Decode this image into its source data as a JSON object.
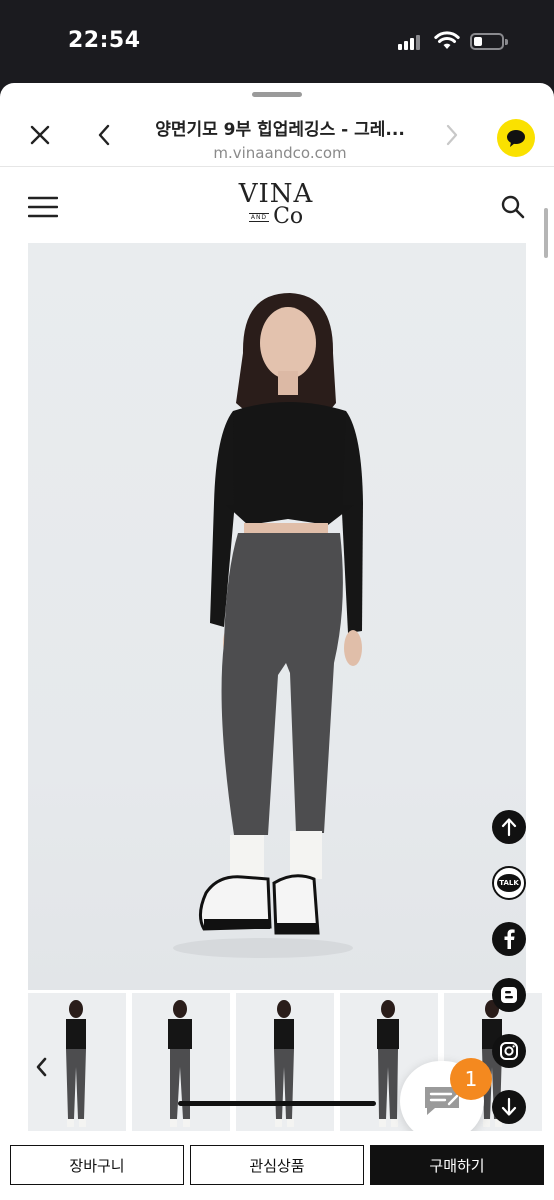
{
  "status_bar": {
    "time": "22:54"
  },
  "browser": {
    "title": "양면기모 9부 힙업레깅스 - 그레...",
    "url": "m.vinaandco.com"
  },
  "site": {
    "logo_top": "VINA",
    "logo_and": "AND",
    "logo_co": "Co"
  },
  "product_images": {
    "main_alt": "model wearing grey leggings",
    "thumbnail_count": 5
  },
  "chat": {
    "badge_count": "1"
  },
  "side_buttons": [
    "scroll-top",
    "kakao-talk",
    "facebook",
    "blogger",
    "instagram",
    "scroll-bottom"
  ],
  "bottom_bar": {
    "cart_label": "장바구니",
    "wishlist_label": "관심상품",
    "buy_label": "구매하기"
  },
  "colors": {
    "kakao": "#fae100",
    "badge": "#f4891f",
    "dark": "#111111"
  }
}
